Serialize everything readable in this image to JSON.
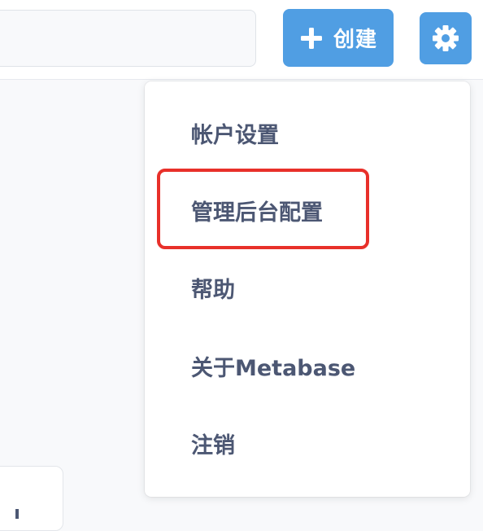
{
  "header": {
    "search": {
      "placeholder": "",
      "value": ""
    },
    "create_button": {
      "label": "创建",
      "icon": "plus-icon"
    },
    "settings_button": {
      "icon": "gear-icon"
    }
  },
  "settings_menu": {
    "items": [
      {
        "label": "帐户设置"
      },
      {
        "label": "管理后台配置",
        "highlighted": true
      },
      {
        "label": "帮助"
      },
      {
        "label": "关于Metabase"
      },
      {
        "label": "注销"
      }
    ]
  },
  "colors": {
    "brand": "#509ee3",
    "menu_text": "#4c5773",
    "highlight_outline": "#e8302a",
    "page_background": "#f8f9fb"
  }
}
